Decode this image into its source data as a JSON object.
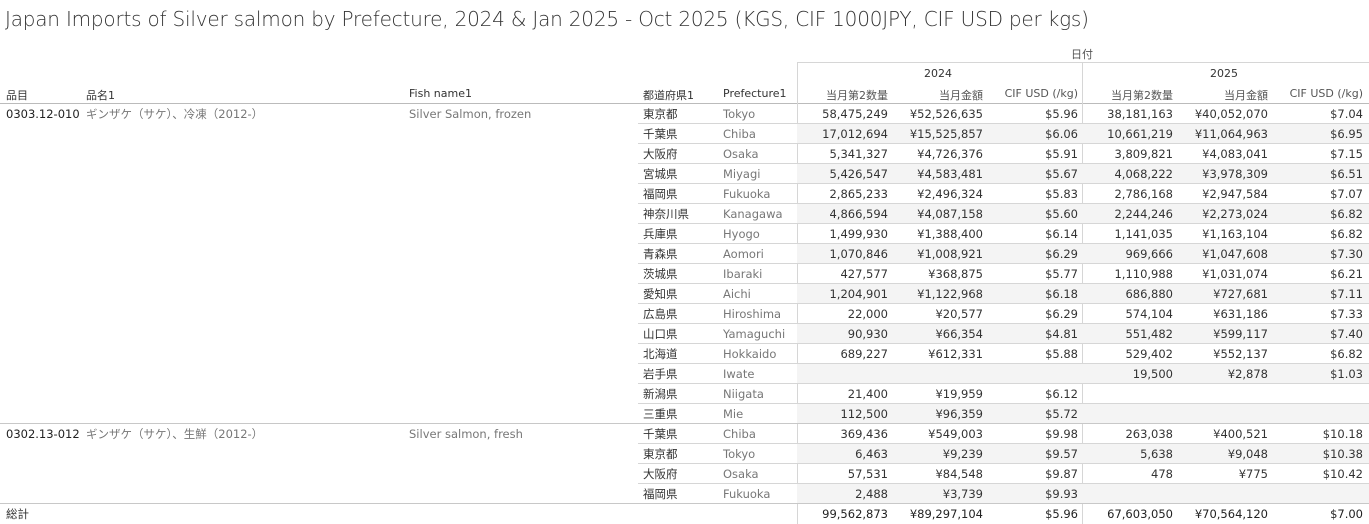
{
  "title": "Japan Imports of Silver salmon by Prefecture, 2024 & Jan 2025 - Oct 2025 (KGS, CIF 1000JPY, CIF USD per kgs)",
  "header": {
    "date_label": "日付",
    "years": [
      "2024",
      "2025"
    ],
    "col_code": "品目",
    "col_name": "品名1",
    "col_fish": "Fish name1",
    "col_pref_jp": "都道府県1",
    "col_pref_en": "Prefecture1",
    "measures": [
      "当月第2数量",
      "当月金額",
      "CIF USD (/kg)"
    ]
  },
  "groups": [
    {
      "code": "0303.12-010",
      "name": "ギンザケ（サケ）、冷凍（2012-）",
      "fish": "Silver Salmon, frozen",
      "rows": [
        {
          "pj": "東京都",
          "pe": "Tokyo",
          "q24": "58,475,249",
          "a24": "¥52,526,635",
          "u24": "$5.96",
          "q25": "38,181,163",
          "a25": "¥40,052,070",
          "u25": "$7.04"
        },
        {
          "pj": "千葉県",
          "pe": "Chiba",
          "q24": "17,012,694",
          "a24": "¥15,525,857",
          "u24": "$6.06",
          "q25": "10,661,219",
          "a25": "¥11,064,963",
          "u25": "$6.95"
        },
        {
          "pj": "大阪府",
          "pe": "Osaka",
          "q24": "5,341,327",
          "a24": "¥4,726,376",
          "u24": "$5.91",
          "q25": "3,809,821",
          "a25": "¥4,083,041",
          "u25": "$7.15"
        },
        {
          "pj": "宮城県",
          "pe": "Miyagi",
          "q24": "5,426,547",
          "a24": "¥4,583,481",
          "u24": "$5.67",
          "q25": "4,068,222",
          "a25": "¥3,978,309",
          "u25": "$6.51"
        },
        {
          "pj": "福岡県",
          "pe": "Fukuoka",
          "q24": "2,865,233",
          "a24": "¥2,496,324",
          "u24": "$5.83",
          "q25": "2,786,168",
          "a25": "¥2,947,584",
          "u25": "$7.07"
        },
        {
          "pj": "神奈川県",
          "pe": "Kanagawa",
          "q24": "4,866,594",
          "a24": "¥4,087,158",
          "u24": "$5.60",
          "q25": "2,244,246",
          "a25": "¥2,273,024",
          "u25": "$6.82"
        },
        {
          "pj": "兵庫県",
          "pe": "Hyogo",
          "q24": "1,499,930",
          "a24": "¥1,388,400",
          "u24": "$6.14",
          "q25": "1,141,035",
          "a25": "¥1,163,104",
          "u25": "$6.82"
        },
        {
          "pj": "青森県",
          "pe": "Aomori",
          "q24": "1,070,846",
          "a24": "¥1,008,921",
          "u24": "$6.29",
          "q25": "969,666",
          "a25": "¥1,047,608",
          "u25": "$7.30"
        },
        {
          "pj": "茨城県",
          "pe": "Ibaraki",
          "q24": "427,577",
          "a24": "¥368,875",
          "u24": "$5.77",
          "q25": "1,110,988",
          "a25": "¥1,031,074",
          "u25": "$6.21"
        },
        {
          "pj": "愛知県",
          "pe": "Aichi",
          "q24": "1,204,901",
          "a24": "¥1,122,968",
          "u24": "$6.18",
          "q25": "686,880",
          "a25": "¥727,681",
          "u25": "$7.11"
        },
        {
          "pj": "広島県",
          "pe": "Hiroshima",
          "q24": "22,000",
          "a24": "¥20,577",
          "u24": "$6.29",
          "q25": "574,104",
          "a25": "¥631,186",
          "u25": "$7.33"
        },
        {
          "pj": "山口県",
          "pe": "Yamaguchi",
          "q24": "90,930",
          "a24": "¥66,354",
          "u24": "$4.81",
          "q25": "551,482",
          "a25": "¥599,117",
          "u25": "$7.40"
        },
        {
          "pj": "北海道",
          "pe": "Hokkaido",
          "q24": "689,227",
          "a24": "¥612,331",
          "u24": "$5.88",
          "q25": "529,402",
          "a25": "¥552,137",
          "u25": "$6.82"
        },
        {
          "pj": "岩手県",
          "pe": "Iwate",
          "q24": "",
          "a24": "",
          "u24": "",
          "q25": "19,500",
          "a25": "¥2,878",
          "u25": "$1.03"
        },
        {
          "pj": "新潟県",
          "pe": "Niigata",
          "q24": "21,400",
          "a24": "¥19,959",
          "u24": "$6.12",
          "q25": "",
          "a25": "",
          "u25": ""
        },
        {
          "pj": "三重県",
          "pe": "Mie",
          "q24": "112,500",
          "a24": "¥96,359",
          "u24": "$5.72",
          "q25": "",
          "a25": "",
          "u25": ""
        }
      ]
    },
    {
      "code": "0302.13-012",
      "name": "ギンザケ（サケ）、生鮮（2012-）",
      "fish": "Silver salmon, fresh",
      "rows": [
        {
          "pj": "千葉県",
          "pe": "Chiba",
          "q24": "369,436",
          "a24": "¥549,003",
          "u24": "$9.98",
          "q25": "263,038",
          "a25": "¥400,521",
          "u25": "$10.18"
        },
        {
          "pj": "東京都",
          "pe": "Tokyo",
          "q24": "6,463",
          "a24": "¥9,239",
          "u24": "$9.57",
          "q25": "5,638",
          "a25": "¥9,048",
          "u25": "$10.38"
        },
        {
          "pj": "大阪府",
          "pe": "Osaka",
          "q24": "57,531",
          "a24": "¥84,548",
          "u24": "$9.87",
          "q25": "478",
          "a25": "¥775",
          "u25": "$10.42"
        },
        {
          "pj": "福岡県",
          "pe": "Fukuoka",
          "q24": "2,488",
          "a24": "¥3,739",
          "u24": "$9.93",
          "q25": "",
          "a25": "",
          "u25": ""
        }
      ]
    }
  ],
  "total": {
    "label": "総計",
    "q24": "99,562,873",
    "a24": "¥89,297,104",
    "u24": "$5.96",
    "q25": "67,603,050",
    "a25": "¥70,564,120",
    "u25": "$7.00"
  }
}
